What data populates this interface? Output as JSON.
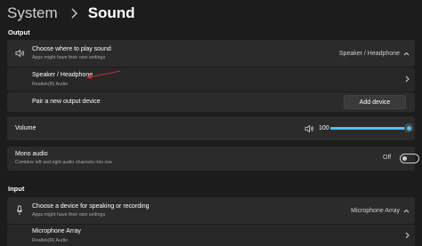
{
  "breadcrumb": {
    "parent": "System",
    "current": "Sound"
  },
  "output": {
    "section_title": "Output",
    "choose": {
      "title": "Choose where to play sound",
      "subtitle": "Apps might have their own settings",
      "selected": "Speaker / Headphone"
    },
    "device": {
      "title": "Speaker / Headphone",
      "subtitle": "Realtek(R) Audio"
    },
    "pair": {
      "title": "Pair a new output device",
      "button_label": "Add device"
    },
    "volume": {
      "title": "Volume",
      "value": "100",
      "level": 1.0
    },
    "mono": {
      "title": "Mono audio",
      "subtitle": "Combine left and right audio channels into one",
      "state_label": "Off"
    }
  },
  "input": {
    "section_title": "Input",
    "choose": {
      "title": "Choose a device for speaking or recording",
      "subtitle": "Apps might have their own settings",
      "selected": "Microphone Array"
    },
    "device": {
      "title": "Microphone Array",
      "subtitle": "Realtek(R) Audio"
    }
  },
  "colors": {
    "accent": "#4cc2ff",
    "annotation_arrow": "#e0262d",
    "background": "#1c1c1c",
    "card": "#2b2b2b"
  },
  "icons": [
    "chevron-right-icon",
    "speaker-icon",
    "chevron-up-icon",
    "volume-icon",
    "microphone-icon"
  ]
}
